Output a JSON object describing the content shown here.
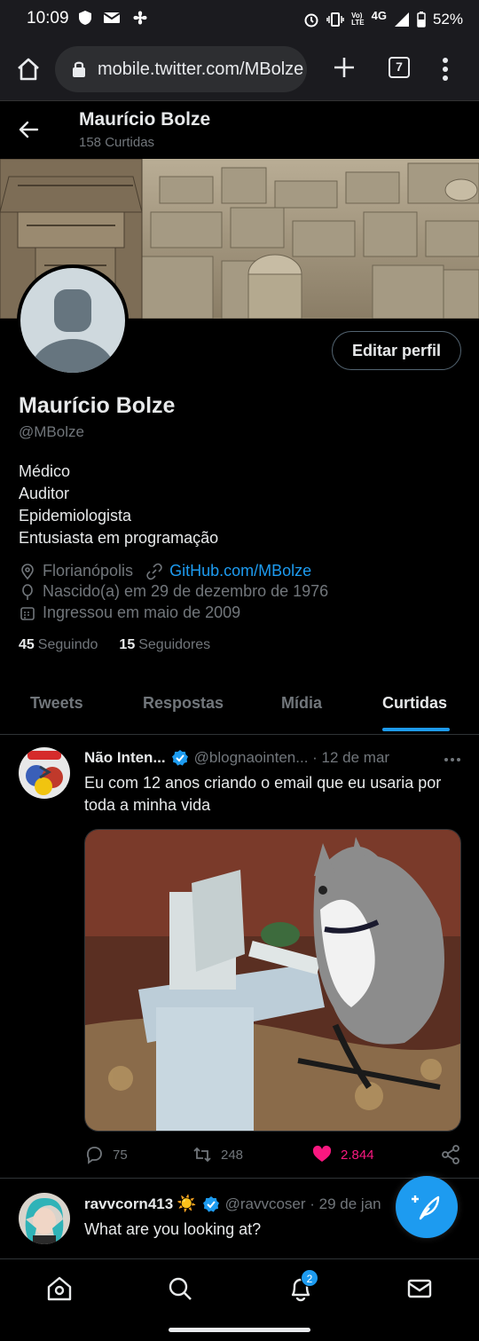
{
  "status_bar": {
    "time": "10:09",
    "network_top": "Vo)",
    "network_bottom": "LTE",
    "signal": "4G",
    "battery": "52%"
  },
  "browser": {
    "url": "mobile.twitter.com/MBolze",
    "tab_count": "7"
  },
  "header": {
    "name": "Maurício Bolze",
    "count": "158 Curtidas"
  },
  "profile": {
    "name": "Maurício Bolze",
    "handle": "@MBolze",
    "edit_label": "Editar perfil",
    "bio": [
      "Médico",
      "Auditor",
      "Epidemiologista",
      "Entusiasta em programação"
    ],
    "location": "Florianópolis",
    "website": "GitHub.com/MBolze",
    "birthday": "Nascido(a) em 29 de dezembro de 1976",
    "joined": "Ingressou em maio de 2009",
    "following_count": "45",
    "following_label": "Seguindo",
    "followers_count": "15",
    "followers_label": "Seguidores"
  },
  "tabs": [
    {
      "label": "Tweets"
    },
    {
      "label": "Respostas"
    },
    {
      "label": "Mídia"
    },
    {
      "label": "Curtidas"
    }
  ],
  "tweets": [
    {
      "name": "Não Inten...",
      "handle_time": "@blognaointen... · 12 de mar",
      "text": "Eu com 12 anos criando o email que eu usaria por toda a minha vida",
      "replies": "75",
      "retweets": "248",
      "likes": "2.844"
    },
    {
      "name": "ravvcorn413",
      "name_emoji": "☀️",
      "handle_time": "@ravvcoser · 29 de jan",
      "text": "What are you looking at?"
    }
  ],
  "notifications_badge": "2",
  "colors": {
    "accent": "#1d9bf0",
    "like": "#f91880",
    "background": "#000000",
    "muted": "#71767b"
  },
  "icons": [
    "home-icon",
    "lock-icon",
    "plus-icon",
    "tabs-icon",
    "menu-icon",
    "back-arrow-icon",
    "location-icon",
    "link-icon",
    "birthday-icon",
    "calendar-icon",
    "verified-icon",
    "reply-icon",
    "retweet-icon",
    "heart-icon",
    "share-icon",
    "compose-icon",
    "search-icon",
    "bell-icon",
    "mail-icon"
  ]
}
